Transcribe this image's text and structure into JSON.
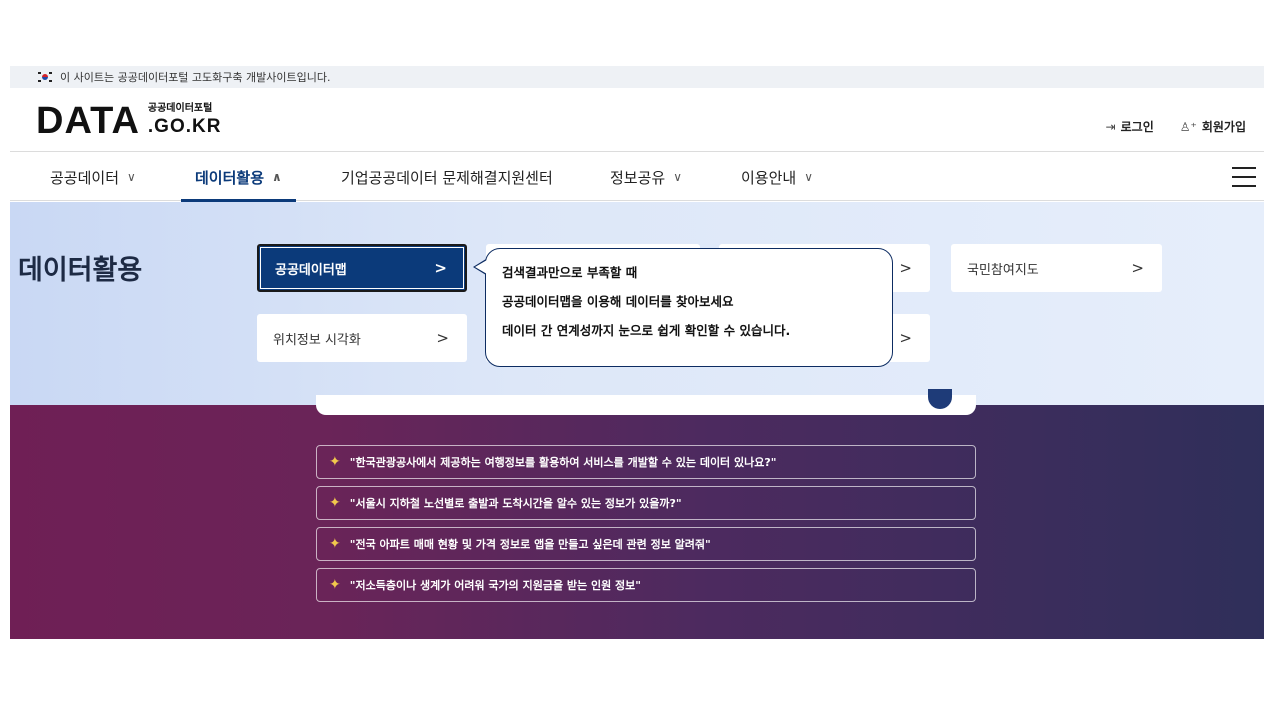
{
  "notice": {
    "text": "이 사이트는 공공데이터포털 고도화구축 개발사이트입니다."
  },
  "header": {
    "logo_main": "DATA",
    "logo_sub_ko": "공공데이터포털",
    "logo_sub_en": ".GO.KR",
    "login_icon": "login-icon",
    "login_label": "로그인",
    "signup_icon": "person-add-icon",
    "signup_label": "회원가입"
  },
  "nav": {
    "items": [
      {
        "label": "공공데이터"
      },
      {
        "label": "데이터활용"
      },
      {
        "label": "기업공공데이터 문제해결지원센터"
      },
      {
        "label": "정보공유"
      },
      {
        "label": "이용안내"
      }
    ]
  },
  "panel": {
    "title": "데이터활용",
    "row1": [
      "공공데이터맵",
      "국민참여지도"
    ],
    "row2": [
      "위치정보 시각화"
    ]
  },
  "tooltip": {
    "lines": [
      "검색결과만으로 부족할 때",
      "공공데이터맵을 이용해 데이터를 찾아보세요",
      "데이터 간 연계성까지 눈으로 쉽게 확인할 수 있습니다."
    ]
  },
  "suggestions": [
    "\"한국관광공사에서 제공하는 여행정보를 활용하여 서비스를 개발할 수 있는 데이터 있나요?\"",
    "\"서울시 지하철 노선별로 출발과 도착시간을 알수 있는 정보가 있을까?\"",
    "\"전국 아파트 매매 현황 및 가격 정보로 앱을 만들고 싶은데 관련 정보 알려줘\"",
    "\"저소득층이나 생계가 어려워 국가의 지원금을 받는 인원 정보\""
  ],
  "colors": {
    "brand_navy": "#0b3a7a",
    "spark": "#f2c94c"
  }
}
